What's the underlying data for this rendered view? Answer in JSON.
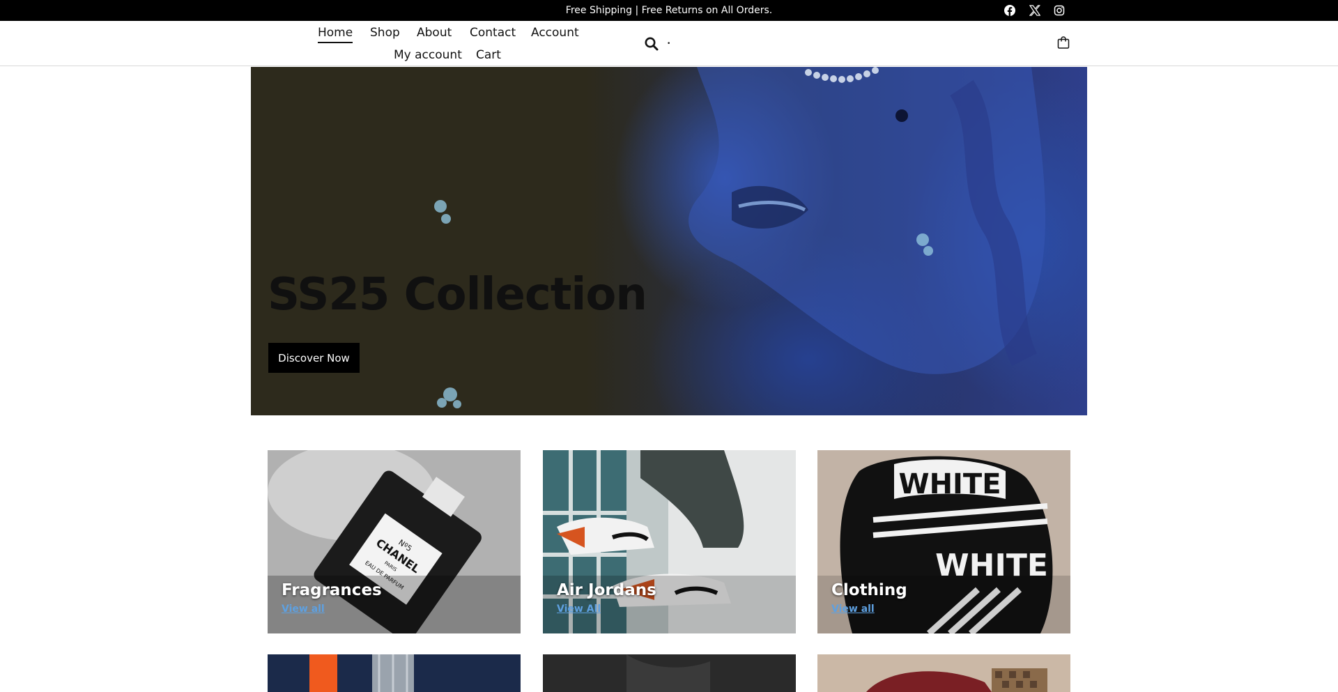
{
  "announcement": {
    "text": "Free Shipping | Free Returns on All Orders."
  },
  "social": {
    "icons": [
      "facebook-icon",
      "x-icon",
      "instagram-icon"
    ]
  },
  "nav": {
    "home": "Home",
    "shop": "Shop",
    "about": "About",
    "contact": "Contact",
    "account": "Account",
    "my_account": "My account",
    "cart": "Cart",
    "active": "Home"
  },
  "header": {
    "search_icon": "search-icon",
    "search_badge": "•",
    "cart_icon": "shopping-bag-icon"
  },
  "hero": {
    "title": "SS25 Collection",
    "button_label": "Discover Now"
  },
  "categories": [
    {
      "title": "Fragrances",
      "link": "View all"
    },
    {
      "title": "Air Jordans",
      "link": "View All"
    },
    {
      "title": "Clothing",
      "link": "View all"
    }
  ],
  "colors": {
    "topbar_bg": "#000000",
    "link_blue": "#5ea0e0",
    "button_bg": "#000000"
  }
}
